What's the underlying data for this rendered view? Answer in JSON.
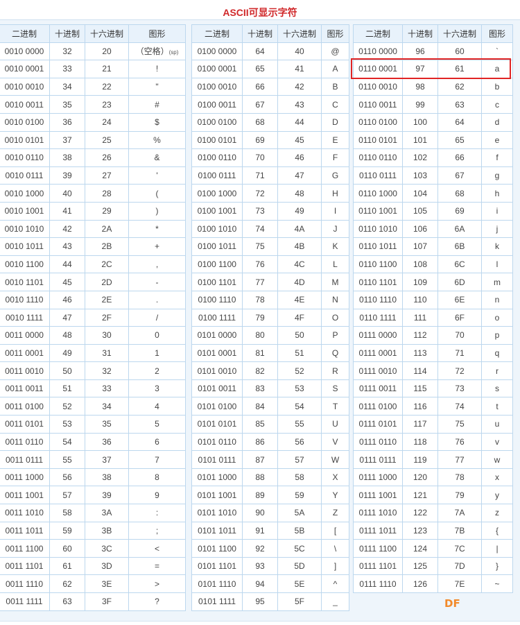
{
  "title": "ASCII可显示字符",
  "headers": [
    "二进制",
    "十进制",
    "十六进制",
    "图形"
  ],
  "space_label": "（空格）",
  "space_sub": "(sp)",
  "watermark": "DF",
  "highlight_color": "#e02424",
  "tables": [
    {
      "rows": [
        [
          "0010 0000",
          "32",
          "20",
          "SP"
        ],
        [
          "0010 0001",
          "33",
          "21",
          "!"
        ],
        [
          "0010 0010",
          "34",
          "22",
          "\""
        ],
        [
          "0010 0011",
          "35",
          "23",
          "#"
        ],
        [
          "0010 0100",
          "36",
          "24",
          "$"
        ],
        [
          "0010 0101",
          "37",
          "25",
          "%"
        ],
        [
          "0010 0110",
          "38",
          "26",
          "&"
        ],
        [
          "0010 0111",
          "39",
          "27",
          "'"
        ],
        [
          "0010 1000",
          "40",
          "28",
          "("
        ],
        [
          "0010 1001",
          "41",
          "29",
          ")"
        ],
        [
          "0010 1010",
          "42",
          "2A",
          "*"
        ],
        [
          "0010 1011",
          "43",
          "2B",
          "+"
        ],
        [
          "0010 1100",
          "44",
          "2C",
          ","
        ],
        [
          "0010 1101",
          "45",
          "2D",
          "-"
        ],
        [
          "0010 1110",
          "46",
          "2E",
          "."
        ],
        [
          "0010 1111",
          "47",
          "2F",
          "/"
        ],
        [
          "0011 0000",
          "48",
          "30",
          "0"
        ],
        [
          "0011 0001",
          "49",
          "31",
          "1"
        ],
        [
          "0011 0010",
          "50",
          "32",
          "2"
        ],
        [
          "0011 0011",
          "51",
          "33",
          "3"
        ],
        [
          "0011 0100",
          "52",
          "34",
          "4"
        ],
        [
          "0011 0101",
          "53",
          "35",
          "5"
        ],
        [
          "0011 0110",
          "54",
          "36",
          "6"
        ],
        [
          "0011 0111",
          "55",
          "37",
          "7"
        ],
        [
          "0011 1000",
          "56",
          "38",
          "8"
        ],
        [
          "0011 1001",
          "57",
          "39",
          "9"
        ],
        [
          "0011 1010",
          "58",
          "3A",
          ":"
        ],
        [
          "0011 1011",
          "59",
          "3B",
          ";"
        ],
        [
          "0011 1100",
          "60",
          "3C",
          "<"
        ],
        [
          "0011 1101",
          "61",
          "3D",
          "="
        ],
        [
          "0011 1110",
          "62",
          "3E",
          ">"
        ],
        [
          "0011 1111",
          "63",
          "3F",
          "?"
        ]
      ]
    },
    {
      "rows": [
        [
          "0100 0000",
          "64",
          "40",
          "@"
        ],
        [
          "0100 0001",
          "65",
          "41",
          "A"
        ],
        [
          "0100 0010",
          "66",
          "42",
          "B"
        ],
        [
          "0100 0011",
          "67",
          "43",
          "C"
        ],
        [
          "0100 0100",
          "68",
          "44",
          "D"
        ],
        [
          "0100 0101",
          "69",
          "45",
          "E"
        ],
        [
          "0100 0110",
          "70",
          "46",
          "F"
        ],
        [
          "0100 0111",
          "71",
          "47",
          "G"
        ],
        [
          "0100 1000",
          "72",
          "48",
          "H"
        ],
        [
          "0100 1001",
          "73",
          "49",
          "I"
        ],
        [
          "0100 1010",
          "74",
          "4A",
          "J"
        ],
        [
          "0100 1011",
          "75",
          "4B",
          "K"
        ],
        [
          "0100 1100",
          "76",
          "4C",
          "L"
        ],
        [
          "0100 1101",
          "77",
          "4D",
          "M"
        ],
        [
          "0100 1110",
          "78",
          "4E",
          "N"
        ],
        [
          "0100 1111",
          "79",
          "4F",
          "O"
        ],
        [
          "0101 0000",
          "80",
          "50",
          "P"
        ],
        [
          "0101 0001",
          "81",
          "51",
          "Q"
        ],
        [
          "0101 0010",
          "82",
          "52",
          "R"
        ],
        [
          "0101 0011",
          "83",
          "53",
          "S"
        ],
        [
          "0101 0100",
          "84",
          "54",
          "T"
        ],
        [
          "0101 0101",
          "85",
          "55",
          "U"
        ],
        [
          "0101 0110",
          "86",
          "56",
          "V"
        ],
        [
          "0101 0111",
          "87",
          "57",
          "W"
        ],
        [
          "0101 1000",
          "88",
          "58",
          "X"
        ],
        [
          "0101 1001",
          "89",
          "59",
          "Y"
        ],
        [
          "0101 1010",
          "90",
          "5A",
          "Z"
        ],
        [
          "0101 1011",
          "91",
          "5B",
          "["
        ],
        [
          "0101 1100",
          "92",
          "5C",
          "\\"
        ],
        [
          "0101 1101",
          "93",
          "5D",
          "]"
        ],
        [
          "0101 1110",
          "94",
          "5E",
          "^"
        ],
        [
          "0101 1111",
          "95",
          "5F",
          "_"
        ]
      ]
    },
    {
      "rows": [
        [
          "0110 0000",
          "96",
          "60",
          "`"
        ],
        [
          "0110 0001",
          "97",
          "61",
          "a"
        ],
        [
          "0110 0010",
          "98",
          "62",
          "b"
        ],
        [
          "0110 0011",
          "99",
          "63",
          "c"
        ],
        [
          "0110 0100",
          "100",
          "64",
          "d"
        ],
        [
          "0110 0101",
          "101",
          "65",
          "e"
        ],
        [
          "0110 0110",
          "102",
          "66",
          "f"
        ],
        [
          "0110 0111",
          "103",
          "67",
          "g"
        ],
        [
          "0110 1000",
          "104",
          "68",
          "h"
        ],
        [
          "0110 1001",
          "105",
          "69",
          "i"
        ],
        [
          "0110 1010",
          "106",
          "6A",
          "j"
        ],
        [
          "0110 1011",
          "107",
          "6B",
          "k"
        ],
        [
          "0110 1100",
          "108",
          "6C",
          "l"
        ],
        [
          "0110 1101",
          "109",
          "6D",
          "m"
        ],
        [
          "0110 1110",
          "110",
          "6E",
          "n"
        ],
        [
          "0110 1111",
          "111",
          "6F",
          "o"
        ],
        [
          "0111 0000",
          "112",
          "70",
          "p"
        ],
        [
          "0111 0001",
          "113",
          "71",
          "q"
        ],
        [
          "0111 0010",
          "114",
          "72",
          "r"
        ],
        [
          "0111 0011",
          "115",
          "73",
          "s"
        ],
        [
          "0111 0100",
          "116",
          "74",
          "t"
        ],
        [
          "0111 0101",
          "117",
          "75",
          "u"
        ],
        [
          "0111 0110",
          "118",
          "76",
          "v"
        ],
        [
          "0111 0111",
          "119",
          "77",
          "w"
        ],
        [
          "0111 1000",
          "120",
          "78",
          "x"
        ],
        [
          "0111 1001",
          "121",
          "79",
          "y"
        ],
        [
          "0111 1010",
          "122",
          "7A",
          "z"
        ],
        [
          "0111 1011",
          "123",
          "7B",
          "{"
        ],
        [
          "0111 1100",
          "124",
          "7C",
          "|"
        ],
        [
          "0111 1101",
          "125",
          "7D",
          "}"
        ],
        [
          "0111 1110",
          "126",
          "7E",
          "~"
        ]
      ]
    }
  ]
}
